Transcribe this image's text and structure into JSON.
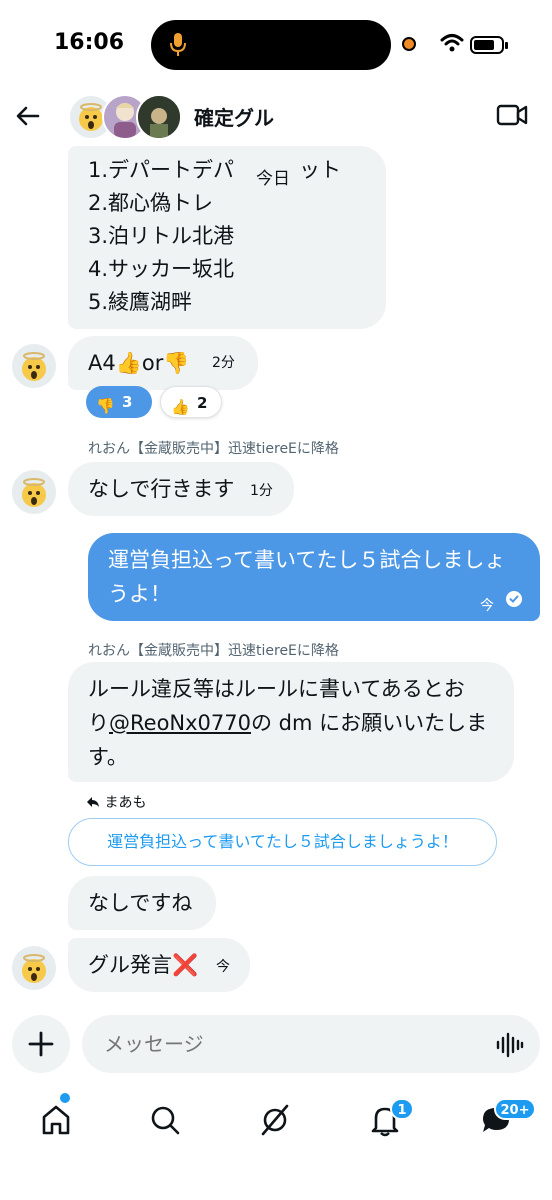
{
  "status_bar": {
    "time": "16:06"
  },
  "header": {
    "group_name": "確定グル"
  },
  "pills": {
    "today": "今日"
  },
  "messages": {
    "list": [
      "1.デパートデパ",
      "2.都心偽トレ",
      "3.泊リトル北港",
      "4.サッカー坂北",
      "5.綾鷹湖畔"
    ],
    "list_tail": "ケット",
    "poll": {
      "text": "A4👍or👎",
      "time": "2分"
    },
    "reactions": [
      {
        "emoji": "👎",
        "count": "3"
      },
      {
        "emoji": "👍",
        "count": "2"
      }
    ],
    "sender_1": "れおん【金蔵販売中】迅速tiereEに降格",
    "nashi": {
      "text": "なしで行きます",
      "time": "1分"
    },
    "own": {
      "line1": "運営負担込って書いてたし５試合しましょ",
      "line2": "うよ！",
      "time": "今"
    },
    "sender_2": "れおん【金蔵販売中】迅速tiereEに降格",
    "rules": {
      "line1": "ルール違反等はルールに書いてあるとお",
      "line2_prefix": "り",
      "mention": "@ReoNx0770",
      "line2_suffix": "の dm にお願いいたしま",
      "line3": "す。"
    },
    "reply": {
      "label": "まあも",
      "quote": "運営負担込って書いてたし５試合しましょうよ！"
    },
    "nashi_desu": "なしですね",
    "guru": {
      "text": "グル発言❌",
      "time": "今"
    }
  },
  "composer": {
    "placeholder": "メッセージ"
  },
  "tabbar": {
    "notifications_badge": "1",
    "messages_badge": "20+"
  },
  "colors": {
    "accent": "#1d9bf0",
    "own_bubble": "#4c97e6",
    "bubble": "#eff3f4"
  }
}
